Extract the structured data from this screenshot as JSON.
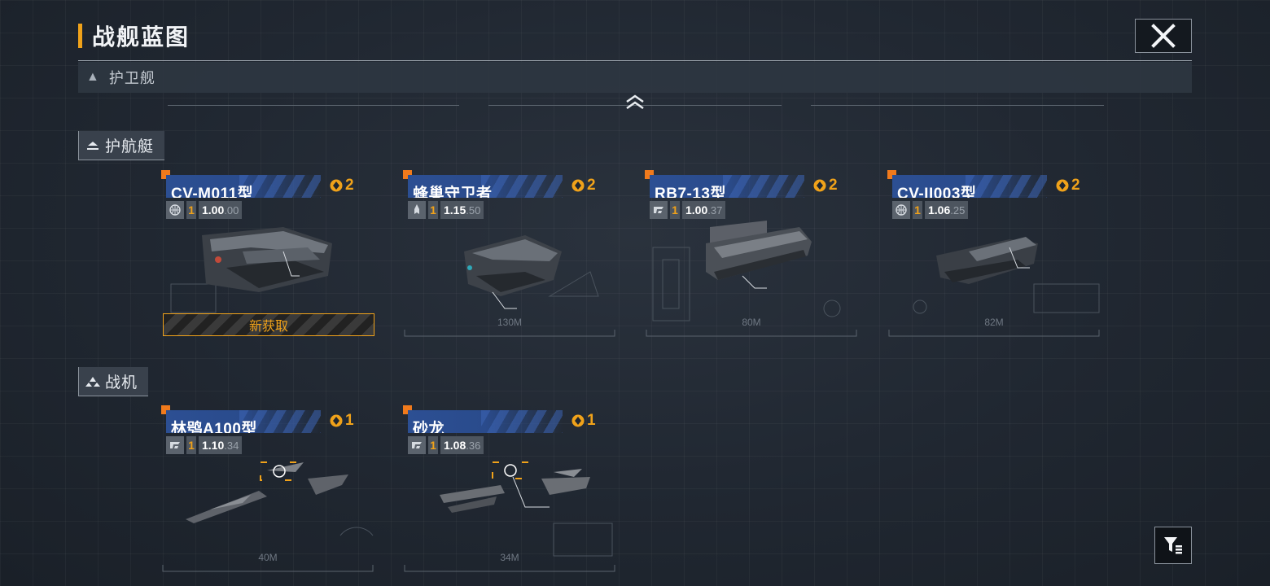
{
  "title": "战舰蓝图",
  "category_header": "护卫舰",
  "sections": [
    {
      "label": "护航艇",
      "cards": [
        {
          "name": "CV-M011型",
          "count": "2",
          "tier": "1",
          "value_main": "1.00",
          "value_frac": ".00",
          "icon": "globe-icon",
          "size": "",
          "new_label": "新获取"
        },
        {
          "name": "蜂巢守卫者",
          "count": "2",
          "tier": "1",
          "value_main": "1.15",
          "value_frac": ".50",
          "icon": "rocket-icon",
          "size": "130M"
        },
        {
          "name": "RB7-13型",
          "count": "2",
          "tier": "1",
          "value_main": "1.00",
          "value_frac": ".37",
          "icon": "manufacturer-icon",
          "size": "80M"
        },
        {
          "name": "CV-II003型",
          "count": "2",
          "tier": "1",
          "value_main": "1.06",
          "value_frac": ".25",
          "icon": "globe-icon",
          "size": "82M"
        }
      ]
    },
    {
      "label": "战机",
      "cards": [
        {
          "name": "林鸮A100型",
          "count": "1",
          "tier": "1",
          "value_main": "1.10",
          "value_frac": ".34",
          "icon": "manufacturer-icon",
          "size": "40M"
        },
        {
          "name": "砂龙",
          "count": "1",
          "tier": "1",
          "value_main": "1.08",
          "value_frac": ".36",
          "icon": "manufacturer-icon",
          "size": "34M"
        }
      ]
    }
  ],
  "colors": {
    "accent": "#f0a21a",
    "corner": "#f07a1c",
    "banner": "#2c4f93"
  },
  "icons": {
    "close": "close-icon",
    "filter": "filter-icon",
    "collapse": "chevron-up-icon",
    "count": "blueprint-icon"
  }
}
